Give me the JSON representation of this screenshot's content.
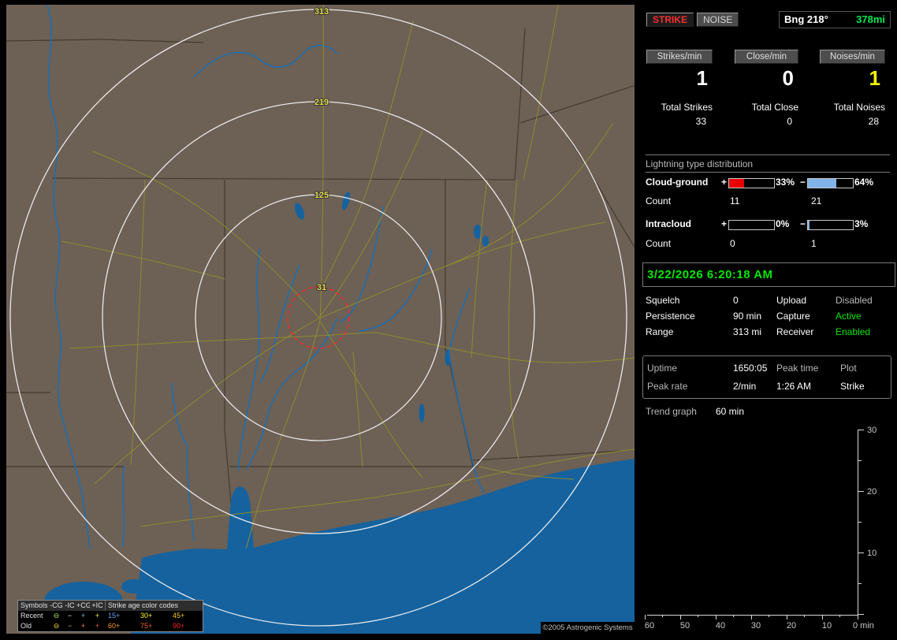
{
  "map": {
    "ring_labels": [
      "313",
      "219",
      "125",
      "31"
    ],
    "copyright": "©2005 Astrogenic Systems",
    "legend": {
      "title": "Symbols",
      "headers": [
        "-CG",
        "-IC",
        "+CG",
        "+IC"
      ],
      "age_title": "Strike age color codes",
      "rows": [
        {
          "label": "Recent",
          "symbols": [
            {
              "glyph": "⊖",
              "color": "#b0e858"
            },
            {
              "glyph": "−",
              "color": "#e8e8e8"
            },
            {
              "glyph": "+",
              "color": "#6ab0f8"
            },
            {
              "glyph": "+",
              "color": "#f8f858"
            }
          ],
          "ages": [
            {
              "label": "15+",
              "color": "#68a0f8"
            },
            {
              "label": "30+",
              "color": "#f8f820"
            },
            {
              "label": "45+",
              "color": "#f8c820"
            }
          ]
        },
        {
          "label": "Old",
          "symbols": [
            {
              "glyph": "⊖",
              "color": "#f8d830"
            },
            {
              "glyph": "−",
              "color": "#f8b830"
            },
            {
              "glyph": "+",
              "color": "#f88830"
            },
            {
              "glyph": "+",
              "color": "#f85030"
            }
          ],
          "ages": [
            {
              "label": "60+",
              "color": "#f89820"
            },
            {
              "label": "75+",
              "color": "#f86020"
            },
            {
              "label": "90+",
              "color": "#f82020"
            }
          ]
        }
      ]
    }
  },
  "panel": {
    "strike": "STRIKE",
    "noise": "NOISE",
    "bearing": "Bng 218°",
    "range": "378mi",
    "rate_cols": [
      {
        "btn": "Strikes/min",
        "value": "1",
        "value_color": "#ffffff",
        "total_label": "Total Strikes",
        "total": "33"
      },
      {
        "btn": "Close/min",
        "value": "0",
        "value_color": "#ffffff",
        "total_label": "Total Close",
        "total": "0"
      },
      {
        "btn": "Noises/min",
        "value": "1",
        "value_color": "#f8f800",
        "total_label": "Total Noises",
        "total": "28"
      }
    ],
    "distribution": {
      "title": "Lightning type distribution",
      "plus": "+",
      "minus": "−",
      "count_label": "Count",
      "rows": [
        {
          "label": "Cloud-ground",
          "pos_pct": "33%",
          "pos_fill": 33,
          "pos_color": "#e80000",
          "neg_pct": "64%",
          "neg_fill": 64,
          "neg_color": "#80b4e8",
          "pos_count": "11",
          "neg_count": "21"
        },
        {
          "label": "Intracloud",
          "pos_pct": "0%",
          "pos_fill": 0,
          "pos_color": "#e80000",
          "neg_pct": "3%",
          "neg_fill": 3,
          "neg_color": "#80b4e8",
          "pos_count": "0",
          "neg_count": "1"
        }
      ]
    },
    "datetime": "3/22/2026 6:20:18 AM",
    "settings": {
      "rows": [
        {
          "l1": "Squelch",
          "v1": "0",
          "l2": "Upload",
          "v2": "Disabled",
          "v2_color": "#b8b8b8"
        },
        {
          "l1": "Persistence",
          "v1": "90 min",
          "l2": "Capture",
          "v2": "Active",
          "v2_color": "#00e800"
        },
        {
          "l1": "Range",
          "v1": "313 mi",
          "l2": "Receiver",
          "v2": "Enabled",
          "v2_color": "#00e800"
        }
      ]
    },
    "status": {
      "uptime_label": "Uptime",
      "uptime": "1650:05",
      "peak_time_label": "Peak time",
      "plot_label": "Plot",
      "peak_rate_label": "Peak rate",
      "peak_rate": "2/min",
      "peak_time": "1:26 AM",
      "plot_value": "Strike"
    },
    "trend_label": "Trend graph",
    "trend_value": "60 min",
    "graph": {
      "y_ticks": [
        "30",
        "20",
        "10"
      ],
      "x_ticks": [
        "60",
        "50",
        "40",
        "30",
        "20",
        "10",
        "0 min"
      ]
    }
  }
}
